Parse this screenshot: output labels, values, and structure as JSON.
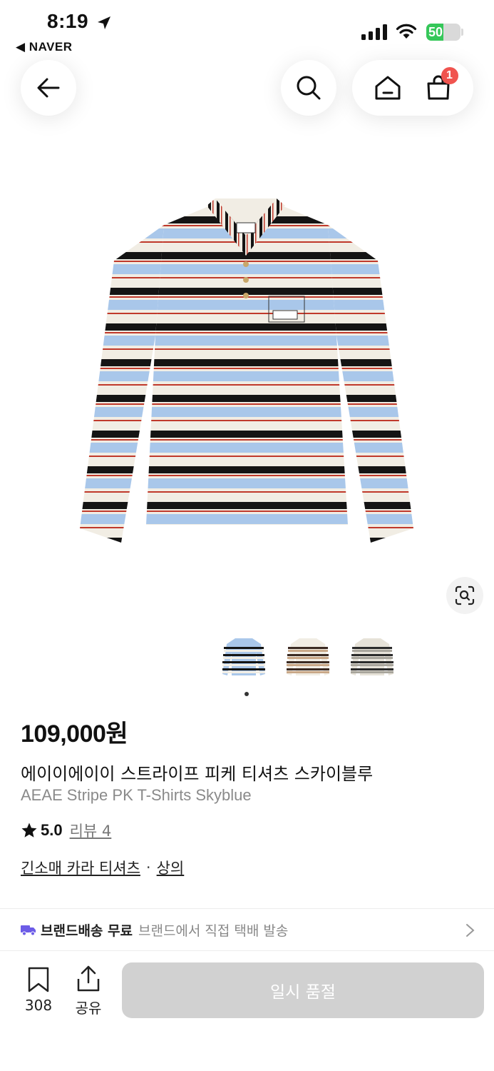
{
  "status_bar": {
    "time": "8:19",
    "back_app": "◀ NAVER",
    "battery": "50",
    "battery_level": 0.5
  },
  "header": {
    "cart_badge": "1"
  },
  "product": {
    "price": "109,000원",
    "title_ko": "에이이에이이 스트라이프 피케 티셔츠 스카이블루",
    "title_en": "AEAE Stripe PK T-Shirts Skyblue",
    "rating": "5.0",
    "review_label": "리뷰 4",
    "category_1": "긴소매 카라 티셔츠",
    "category_sep": "·",
    "category_2": "상의",
    "selected_thumb": 0
  },
  "shipping": {
    "label": "브랜드배송 무료",
    "sub": "브랜드에서 직접 택배 발송"
  },
  "bottom_bar": {
    "save_count": "308",
    "share_label": "공유",
    "soldout_label": "일시 품절"
  },
  "colors": {
    "accent_badge": "#f0544f",
    "battery_green": "#35c759",
    "truck_purple": "#6c5ce7",
    "soldout_gray": "#d1d1d1"
  },
  "icons": [
    "location-arrow-icon",
    "signal-icon",
    "wifi-icon",
    "back-arrow-icon",
    "search-icon",
    "home-icon",
    "cart-bag-icon",
    "lens-search-icon",
    "truck-icon",
    "chevron-right-icon",
    "bookmark-icon",
    "share-icon",
    "star-icon"
  ]
}
